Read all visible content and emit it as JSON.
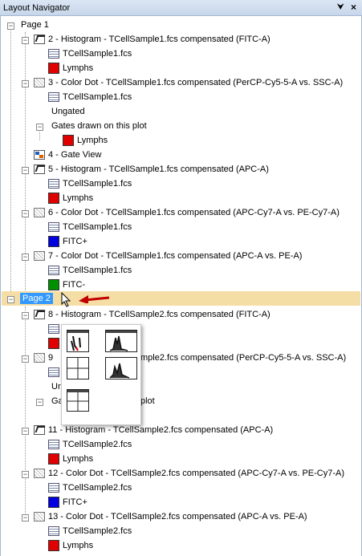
{
  "panel": {
    "title": "Layout Navigator",
    "pin_glyph": "⮟",
    "close_glyph": "×"
  },
  "tree": {
    "page1": {
      "label": "Page 1"
    },
    "p1_items": [
      {
        "label": "2 - Histogram - TCellSample1.fcs compensated (FITC-A)"
      },
      {
        "label": "TCellSample1.fcs"
      },
      {
        "label": "Lymphs"
      },
      {
        "label": "3 - Color Dot - TCellSample1.fcs compensated (PerCP-Cy5-5-A vs. SSC-A)"
      },
      {
        "label": "TCellSample1.fcs"
      },
      {
        "label": "Ungated"
      },
      {
        "label": "Gates drawn on this plot"
      },
      {
        "label": "Lymphs"
      },
      {
        "label": "4 - Gate View"
      },
      {
        "label": "5 - Histogram - TCellSample1.fcs compensated (APC-A)"
      },
      {
        "label": "TCellSample1.fcs"
      },
      {
        "label": "Lymphs"
      },
      {
        "label": "6 - Color Dot - TCellSample1.fcs compensated (APC-Cy7-A vs. PE-Cy7-A)"
      },
      {
        "label": "TCellSample1.fcs"
      },
      {
        "label": "FITC+"
      },
      {
        "label": "7 - Color Dot - TCellSample1.fcs compensated (APC-A vs. PE-A)"
      },
      {
        "label": "TCellSample1.fcs"
      },
      {
        "label": "FITC-"
      }
    ],
    "page2": {
      "label": "Page 2"
    },
    "p2_items": [
      {
        "label": "8 - Histogram - TCellSample2.fcs compensated (FITC-A)"
      },
      {
        "label": "9"
      },
      {
        "label": "mple2.fcs compensated (PerCP-Cy5-5-A vs. SSC-A)"
      },
      {
        "label": "Ur"
      },
      {
        "label": "Ga"
      },
      {
        "label": "plot"
      },
      {
        "label": "11 - Histogram - TCellSample2.fcs compensated (APC-A)"
      },
      {
        "label": "TCellSample2.fcs"
      },
      {
        "label": "Lymphs"
      },
      {
        "label": "12 - Color Dot - TCellSample2.fcs compensated (APC-Cy7-A vs. PE-Cy7-A)"
      },
      {
        "label": "TCellSample2.fcs"
      },
      {
        "label": "FITC+"
      },
      {
        "label": "13 - Color Dot - TCellSample2.fcs compensated (APC-A vs. PE-A)"
      },
      {
        "label": "TCellSample2.fcs"
      },
      {
        "label": "Lymphs"
      }
    ]
  },
  "colors": {
    "red": "#e00000",
    "blue": "#0000e0",
    "green": "#009000",
    "highlight": "#f5dea5",
    "selection": "#3399ff",
    "arrow": "#c00000"
  }
}
